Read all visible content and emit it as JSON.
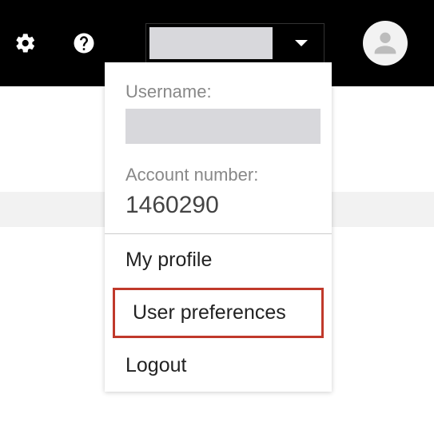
{
  "header": {
    "gear_icon_name": "settings",
    "help_icon_name": "help",
    "user_display": "",
    "avatar_name": "user-avatar"
  },
  "dropdown": {
    "username_label": "Username:",
    "username_value": "",
    "account_label": "Account number:",
    "account_number": "1460290",
    "items": [
      {
        "label": "My profile",
        "highlighted": false
      },
      {
        "label": "User preferences",
        "highlighted": true
      },
      {
        "label": "Logout",
        "highlighted": false
      }
    ]
  }
}
